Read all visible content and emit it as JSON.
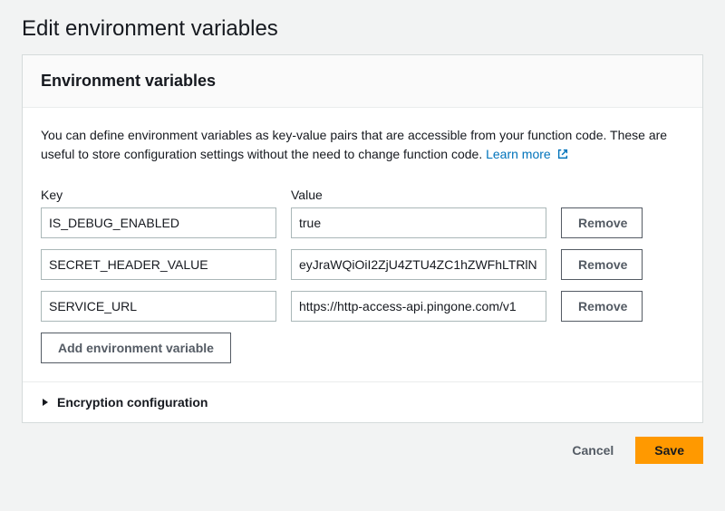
{
  "page": {
    "title": "Edit environment variables"
  },
  "panel": {
    "header": "Environment variables",
    "description_1": "You can define environment variables as key-value pairs that are accessible from your function code. These are useful to store configuration settings without the need to change function code. ",
    "learn_more": "Learn more"
  },
  "columns": {
    "key": "Key",
    "value": "Value"
  },
  "rows": [
    {
      "key": "IS_DEBUG_ENABLED",
      "value": "true"
    },
    {
      "key": "SECRET_HEADER_VALUE",
      "value": "eyJraWQiOiI2ZjU4ZTU4ZC1hZWFhLTRlN"
    },
    {
      "key": "SERVICE_URL",
      "value": "https://http-access-api.pingone.com/v1"
    }
  ],
  "buttons": {
    "remove": "Remove",
    "add": "Add environment variable",
    "cancel": "Cancel",
    "save": "Save"
  },
  "expand": {
    "encryption": "Encryption configuration"
  }
}
